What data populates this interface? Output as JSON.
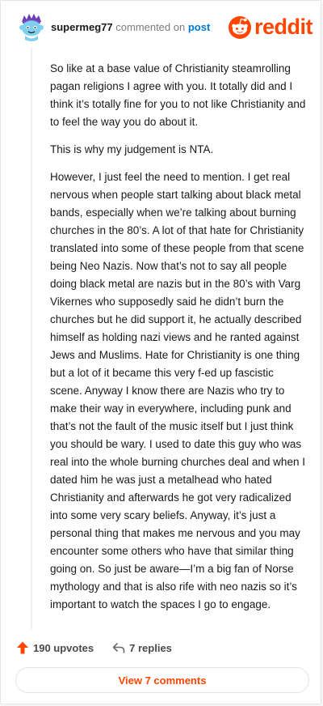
{
  "comment": {
    "username": "supermeg77",
    "action_text": "commented on",
    "post_link": "post",
    "brand": "reddit",
    "paragraphs": [
      "So like at a base value of Christianity steamrolling pagan religions I agree with you. It totally did and I think it’s totally fine for you to not like Christianity and to feel the way you do about it.",
      "This is why my judgement is NTA.",
      "However, I just feel the need to mention. I get real nervous when people start talking about black metal bands, especially when we’re talking about burning churches in the 80’s. A lot of that hate for Christianity translated into some of these people from that scene being Neo Nazis. Now that’s not to say all people doing black metal are nazis but in the 80’s with Varg Vikernes who supposedly said he didn’t burn the churches but he did support it, he actually described himself as holding nazi views and he ranted against Jews and Muslims. Hate for Christianity is one thing but a lot of it became this very f-ed up fascistic scene. Anyway I know there are Nazis who try to make their way in everywhere, including punk and that’s not the fault of the music itself but I just think you should be wary. I used to date this guy who was real into the whole burning churches deal and when I dated him he was just a metalhead who hated Christianity and afterwards he got very radicalized into some very scary beliefs. Anyway, it’s just a personal thing that makes me nervous and you may encounter some others who have that similar thing going on. So just be aware—I’m a big fan of Norse mythology and that is also rife with neo nazis so it’s important to watch the spaces I go to engage."
    ]
  },
  "actions": {
    "upvotes": "190 upvotes",
    "replies": "7 replies"
  },
  "footer": {
    "view_comments": "View 7 comments"
  },
  "colors": {
    "brand": "#ff4500",
    "link": "#0079d3",
    "text": "#1a1a1b"
  },
  "icons": {
    "avatar": "snoo-avatar",
    "logo": "reddit-logo-icon",
    "upvote": "upvote-arrow-icon",
    "reply": "reply-arrow-icon"
  }
}
